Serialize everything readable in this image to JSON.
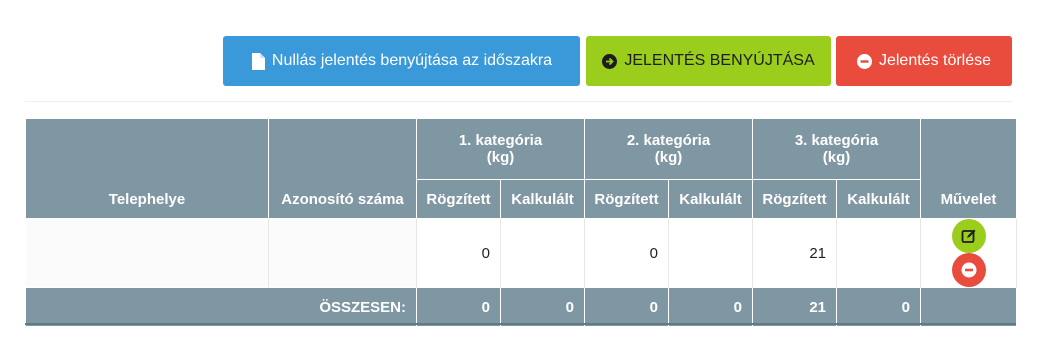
{
  "toolbar": {
    "zero_report_label": "Nullás jelentés benyújtása az időszakra",
    "zero_report_icon": "document-icon",
    "submit_label": "JELENTÉS BENYÚJTÁSA",
    "submit_icon": "circle-arrow-right-icon",
    "delete_label": "Jelentés törlése",
    "delete_icon": "circle-minus-icon"
  },
  "colors": {
    "primary": "#3a9ad9",
    "success": "#9acd1c",
    "danger": "#e94b3c",
    "table_header": "#7f97a3"
  },
  "table": {
    "headers": {
      "site": "Telephelye",
      "id": "Azonosító száma",
      "cat1": "1. kategória\n(kg)",
      "cat2": "2. kategória\n(kg)",
      "cat3": "3. kategória\n(kg)",
      "action": "Művelet"
    },
    "subheaders": {
      "recorded": "Rögzített",
      "calculated": "Kalkulált"
    },
    "rows": [
      {
        "site": "",
        "id": "",
        "cat1_recorded": "0",
        "cat1_calculated": "",
        "cat2_recorded": "0",
        "cat2_calculated": "",
        "cat3_recorded": "21",
        "cat3_calculated": "",
        "actions": [
          "edit-icon",
          "delete-icon"
        ]
      }
    ],
    "total": {
      "label": "ÖSSZESEN:",
      "cat1_recorded": "0",
      "cat1_calculated": "0",
      "cat2_recorded": "0",
      "cat2_calculated": "0",
      "cat3_recorded": "21",
      "cat3_calculated": "0"
    }
  }
}
